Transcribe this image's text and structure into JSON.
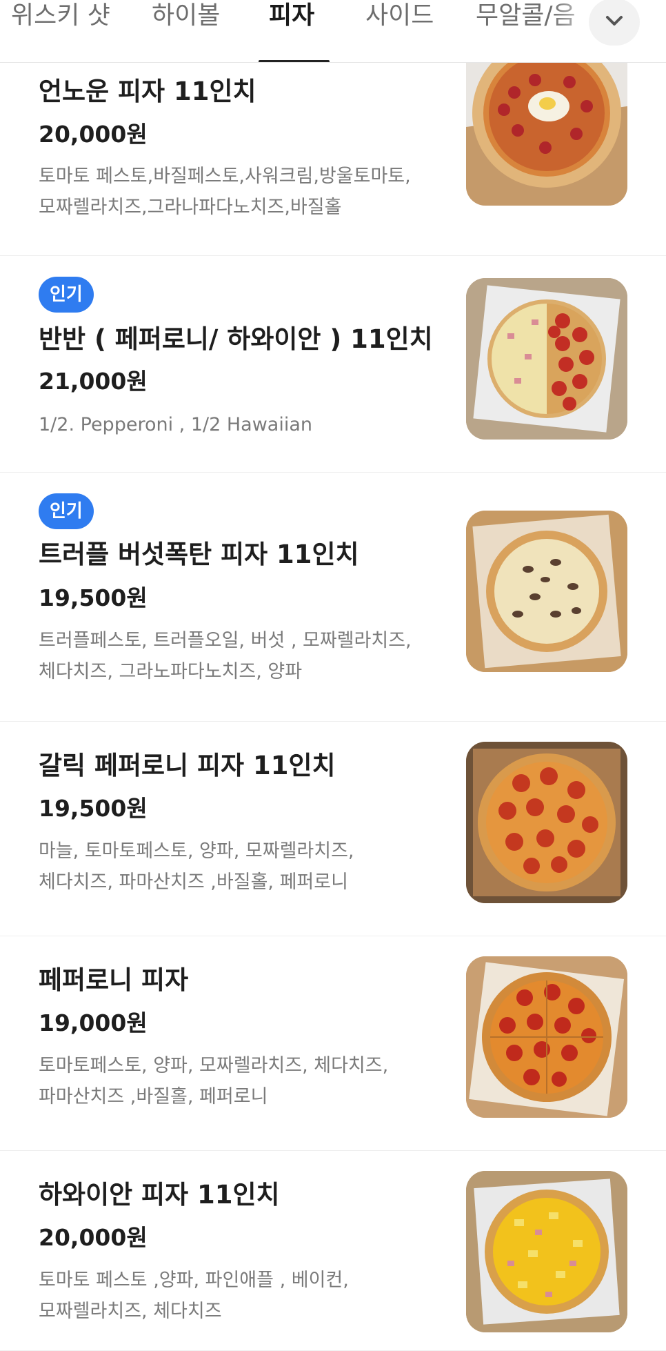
{
  "tabs": [
    {
      "label": "위스키 샷",
      "active": false
    },
    {
      "label": "하이볼",
      "active": false
    },
    {
      "label": "피자",
      "active": true
    },
    {
      "label": "사이드",
      "active": false
    },
    {
      "label": "무알콜/음",
      "active": false
    }
  ],
  "menu": [
    {
      "badge": "",
      "name": "언노운 피자 11인치",
      "price": "20,000원",
      "desc": [
        "토마토 페스토,바질페스토,사워크림,방울토마토,",
        "모짜렐라치즈,그라나파다노치즈,바질홀"
      ]
    },
    {
      "badge": "인기",
      "name": "반반 ( 페퍼로니/ 하와이안 ) 11인치",
      "price": "21,000원",
      "desc": [
        "1/2. Pepperoni , 1/2 Hawaiian"
      ]
    },
    {
      "badge": "인기",
      "name": "트러플 버섯폭탄 피자 11인치",
      "price": "19,500원",
      "desc": [
        "트러플페스토, 트러플오일, 버섯 , 모짜렐라치즈,",
        "체다치즈, 그라노파다노치즈, 양파"
      ]
    },
    {
      "badge": "",
      "name": "갈릭 페퍼로니 피자 11인치",
      "price": "19,500원",
      "desc": [
        "마늘, 토마토페스토, 양파, 모짜렐라치즈,",
        "체다치즈, 파마산치즈 ,바질홀, 페퍼로니"
      ]
    },
    {
      "badge": "",
      "name": "페퍼로니 피자",
      "price": "19,000원",
      "desc": [
        "토마토페스토, 양파, 모짜렐라치즈, 체다치즈,",
        "파마산치즈 ,바질홀, 페퍼로니"
      ]
    },
    {
      "badge": "",
      "name": "하와이안 피자 11인치",
      "price": "20,000원",
      "desc": [
        "토마토 페스토 ,양파, 파인애플 , 베이컨,",
        "모짜렐라치즈, 체다치즈"
      ]
    }
  ],
  "icons": {
    "expand": "chevron-down-icon",
    "thumbnails": [
      "unknown-pizza-photo",
      "half-half-pizza-photo",
      "truffle-mushroom-pizza-photo",
      "garlic-pepperoni-pizza-photo",
      "pepperoni-pizza-photo",
      "hawaiian-pizza-photo"
    ]
  },
  "colors": {
    "badge": "#2f7cf0",
    "active_tab": "#1a1a1a",
    "inactive_tab": "#6e6e6e",
    "description": "#7a7a7a"
  }
}
